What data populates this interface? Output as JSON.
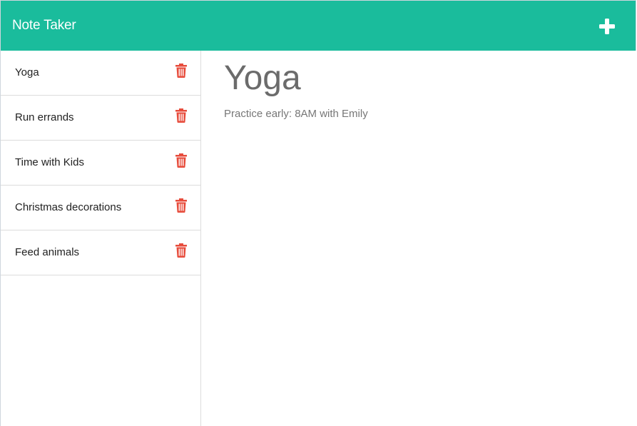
{
  "navbar": {
    "brand": "Note Taker",
    "new_note_icon": "plus-icon"
  },
  "sidebar": {
    "delete_icon": "trash-icon",
    "delete_color": "#e74c3c",
    "notes": [
      {
        "title": "Yoga"
      },
      {
        "title": "Run errands"
      },
      {
        "title": "Time with Kids"
      },
      {
        "title": "Christmas decorations"
      },
      {
        "title": "Feed animals"
      }
    ]
  },
  "active_note": {
    "title": "Yoga",
    "text": "Practice early: 8AM with Emily"
  },
  "colors": {
    "navbar": "#1abc9c",
    "delete": "#e74c3c"
  }
}
